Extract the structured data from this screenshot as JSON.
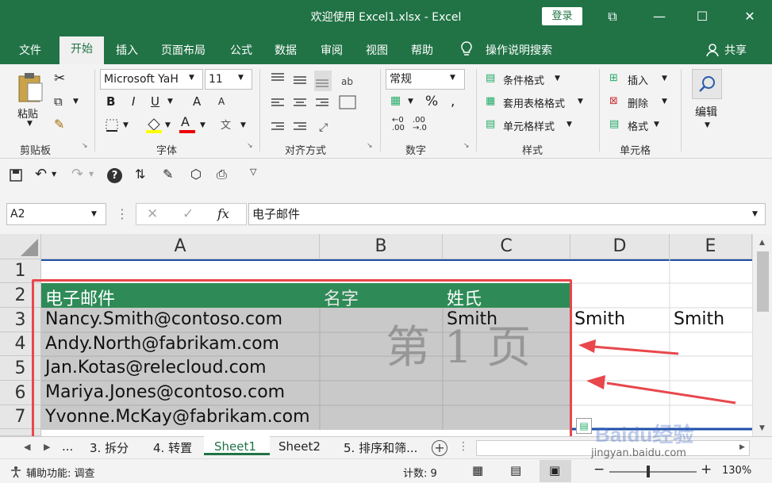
{
  "window": {
    "title": "欢迎使用 Excel1.xlsx  -  Excel",
    "sign_in": "登录",
    "btn_restore": "⧉",
    "btn_min": "—",
    "btn_max": "☐",
    "btn_close": "✕"
  },
  "menu": {
    "tabs": [
      "文件",
      "开始",
      "插入",
      "页面布局",
      "公式",
      "数据",
      "审阅",
      "视图",
      "帮助"
    ],
    "active": "开始",
    "search": "操作说明搜索",
    "share": "共享"
  },
  "ribbon": {
    "clipboard": {
      "label": "剪贴板",
      "paste": "粘贴"
    },
    "font": {
      "label": "字体",
      "name": "Microsoft YaH",
      "size": "11",
      "bold": "B",
      "italic": "I",
      "underline": "U",
      "grow": "A",
      "shrink": "A",
      "color": "A"
    },
    "alignment": {
      "label": "对齐方式"
    },
    "number": {
      "label": "数字",
      "format": "常规",
      "percent": "%"
    },
    "styles": {
      "label": "样式",
      "conditional": "条件格式",
      "table": "套用表格格式",
      "cell_styles": "单元格样式"
    },
    "cells": {
      "label": "单元格",
      "insert": "插入",
      "delete": "删除",
      "format": "格式"
    },
    "editing": {
      "label": "编辑"
    }
  },
  "formula_bar": {
    "name_box": "A2",
    "cancel": "✕",
    "enter": "✓",
    "fx": "fx",
    "content": "电子邮件"
  },
  "grid": {
    "columns": [
      "A",
      "B",
      "C",
      "D",
      "E"
    ],
    "rows": [
      "1",
      "2",
      "3",
      "4",
      "5",
      "6",
      "7"
    ],
    "cells": {
      "A2": "电子邮件",
      "B2": "名字",
      "C2": "姓氏",
      "A3": "Nancy.Smith@contoso.com",
      "C3": "Smith",
      "D3": "Smith",
      "E3": "Smith",
      "A4": "Andy.North@fabrikam.com",
      "A5": "Jan.Kotas@relecloud.com",
      "A6": "Mariya.Jones@contoso.com",
      "A7": "Yvonne.McKay@fabrikam.com"
    },
    "page_watermark": "第 1 页",
    "header_color": "#2e8b57",
    "selection_color": "#c9c9c9",
    "highlight_color": "#e8474c"
  },
  "sheets": {
    "tabs": [
      "...",
      "3. 拆分",
      "4. 转置",
      "Sheet1",
      "Sheet2",
      "5. 排序和筛..."
    ],
    "active": "Sheet1"
  },
  "status": {
    "accessibility": "辅助功能: 调查",
    "count": "计数: 9",
    "zoom": "130%"
  },
  "watermark": {
    "site": "jingyan.baidu.com",
    "logo": "Baidu经验"
  }
}
